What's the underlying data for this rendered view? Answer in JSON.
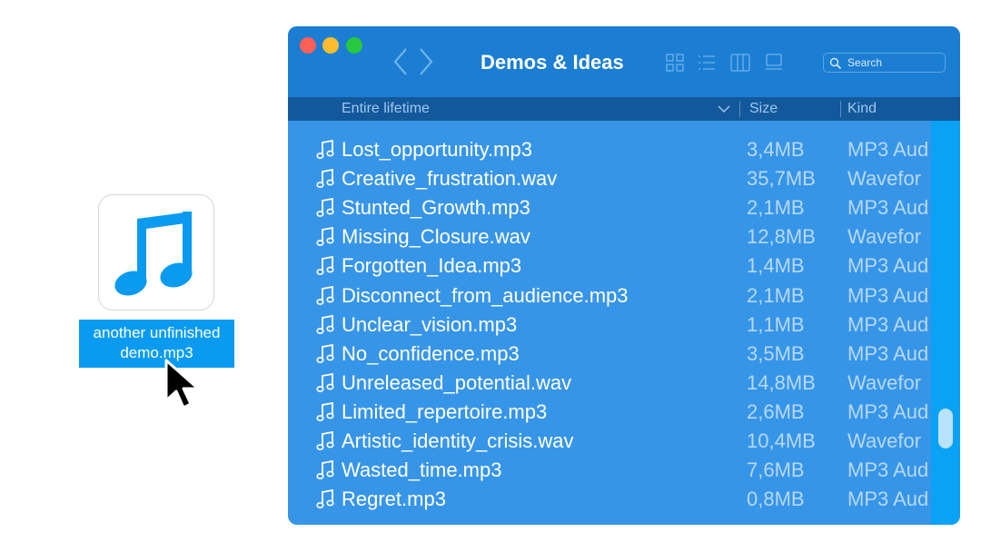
{
  "desktop_file": {
    "label_line1": "another unfinished",
    "label_line2": "demo.mp3",
    "icon": "music-note-icon",
    "accent": "#0a9bf0"
  },
  "window": {
    "title": "Demos & Ideas",
    "search_placeholder": "Search",
    "columns": {
      "name": "Entire lifetime",
      "size": "Size",
      "kind": "Kind"
    },
    "files": [
      {
        "name": "Lost_opportunity.mp3",
        "size": "3,4MB",
        "kind": "MP3 Aud"
      },
      {
        "name": "Creative_frustration.wav",
        "size": "35,7MB",
        "kind": "Wavefor"
      },
      {
        "name": "Stunted_Growth.mp3",
        "size": "2,1MB",
        "kind": "MP3 Aud"
      },
      {
        "name": "Missing_Closure.wav",
        "size": "12,8MB",
        "kind": "Wavefor"
      },
      {
        "name": "Forgotten_Idea.mp3",
        "size": "1,4MB",
        "kind": "MP3 Aud"
      },
      {
        "name": "Disconnect_from_audience.mp3",
        "size": "2,1MB",
        "kind": "MP3 Aud"
      },
      {
        "name": "Unclear_vision.mp3",
        "size": "1,1MB",
        "kind": "MP3 Aud"
      },
      {
        "name": "No_confidence.mp3",
        "size": "3,5MB",
        "kind": "MP3 Aud"
      },
      {
        "name": "Unreleased_potential.wav",
        "size": "14,8MB",
        "kind": "Wavefor"
      },
      {
        "name": "Limited_repertoire.mp3",
        "size": "2,6MB",
        "kind": "MP3 Aud"
      },
      {
        "name": "Artistic_identity_crisis.wav",
        "size": "10,4MB",
        "kind": "Wavefor"
      },
      {
        "name": "Wasted_time.mp3",
        "size": "7,6MB",
        "kind": "MP3 Aud"
      },
      {
        "name": "Regret.mp3",
        "size": "0,8MB",
        "kind": "MP3 Aud"
      }
    ],
    "colors": {
      "titlebar": "#1b7ed3",
      "list_bg": "#3795e8",
      "scrollbar": "#09a2f4"
    }
  }
}
